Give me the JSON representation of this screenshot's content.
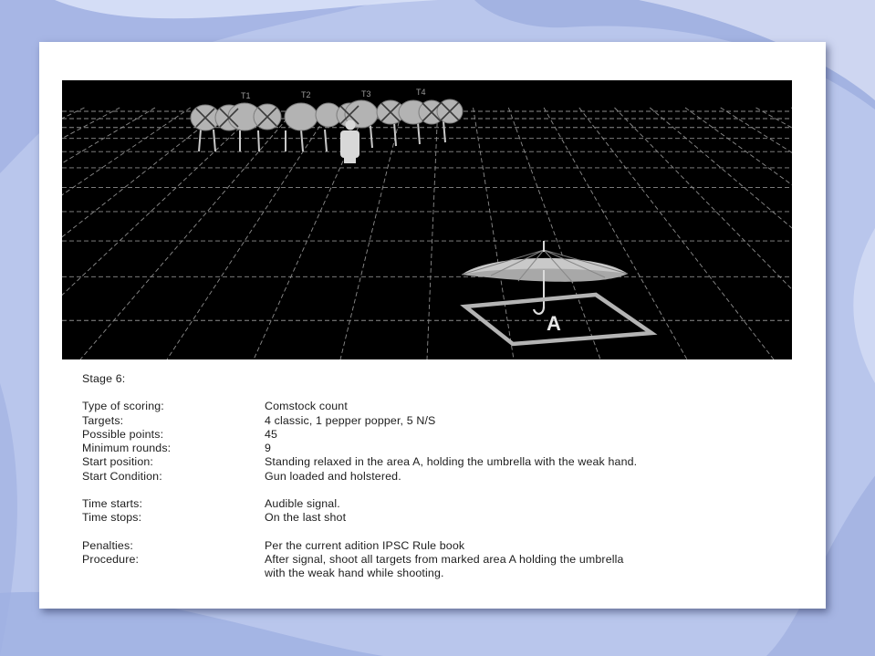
{
  "colors": {
    "background": "#b9c6ec",
    "card": "#ffffff",
    "scene_background": "#000000",
    "grid_lines": "#8c8c8c",
    "target_fill": "#b0b0b0",
    "text": "#1c1c1c"
  },
  "scene": {
    "target_labels": [
      "T1",
      "T2",
      "T3",
      "T4"
    ],
    "area_label": "A"
  },
  "stage": {
    "title": "Stage 6:",
    "groups": [
      [
        {
          "label": "Type of scoring:",
          "value": "Comstock count"
        },
        {
          "label": "Targets:",
          "value": "4 classic, 1 pepper popper, 5 N/S"
        },
        {
          "label": "Possible points:",
          "value": "45"
        },
        {
          "label": "Minimum rounds:",
          "value": "9"
        },
        {
          "label": "Start position:",
          "value": "Standing relaxed in the area A, holding the umbrella with the  weak hand."
        },
        {
          "label": "Start Condition:",
          "value": "Gun loaded and holstered."
        }
      ],
      [
        {
          "label": "Time starts:",
          "value": "Audible signal."
        },
        {
          "label": "Time stops:",
          "value": "On the last shot"
        }
      ],
      [
        {
          "label": "Penalties:",
          "value": "Per the current adition IPSC Rule book"
        },
        {
          "label": "Procedure:",
          "value": "After signal, shoot all targets from marked area A holding the umbrella"
        },
        {
          "label": "",
          "value": "with the weak hand while shooting."
        }
      ]
    ]
  }
}
